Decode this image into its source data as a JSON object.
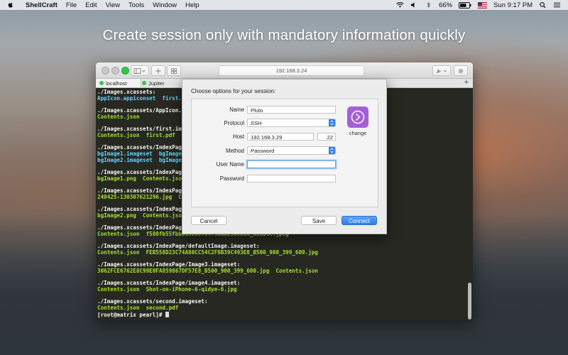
{
  "menubar": {
    "app_name": "ShellCraft",
    "items": [
      "File",
      "Edit",
      "View",
      "Tools",
      "Window",
      "Help"
    ],
    "battery": "66%",
    "clock": "Sun 9:17 PM"
  },
  "headline": "Create session only with mandatory information quickly",
  "window": {
    "address": "192.168.3.24",
    "tabs": [
      {
        "label": "localhost",
        "status_color": "#2ec84a"
      },
      {
        "label": "Jupiter",
        "status_color": "#2ec84a"
      }
    ],
    "new_tab": "+"
  },
  "terminal": {
    "lines": [
      {
        "segments": [
          {
            "text": "./Images.xcassets:",
            "cls": "dir"
          }
        ]
      },
      {
        "segments": [
          {
            "text": "AppIcon.appiconset  first.i",
            "cls": "cyan"
          }
        ]
      },
      {
        "segments": []
      },
      {
        "segments": [
          {
            "text": "./Images.xcassets/AppIcon.ap",
            "cls": "dir"
          }
        ]
      },
      {
        "segments": [
          {
            "text": "Contents.json",
            "cls": "green"
          }
        ]
      },
      {
        "segments": []
      },
      {
        "segments": [
          {
            "text": "./Images.xcassets/first.imag",
            "cls": "dir"
          }
        ]
      },
      {
        "segments": [
          {
            "text": "Contents.json  first.pdf",
            "cls": "green"
          }
        ]
      },
      {
        "segments": []
      },
      {
        "segments": [
          {
            "text": "./Images.xcassets/IndexPage:",
            "cls": "dir"
          }
        ]
      },
      {
        "segments": [
          {
            "text": "bgImage1.imageset  bgImage3",
            "cls": "cyan"
          }
        ]
      },
      {
        "segments": [
          {
            "text": "bgImage2.imageset  bgImage4",
            "cls": "cyan"
          }
        ]
      },
      {
        "segments": []
      },
      {
        "segments": [
          {
            "text": "./Images.xcassets/IndexPage/",
            "cls": "dir"
          }
        ]
      },
      {
        "segments": [
          {
            "text": "bgImage1.png  Contents.json",
            "cls": "green"
          }
        ]
      },
      {
        "segments": []
      },
      {
        "segments": [
          {
            "text": "./Images.xcassets/IndexPage/",
            "cls": "dir"
          }
        ]
      },
      {
        "segments": [
          {
            "text": "240425-130307621296.jpg  Co",
            "cls": "green"
          }
        ]
      },
      {
        "segments": []
      },
      {
        "segments": [
          {
            "text": "./Images.xcassets/IndexPage/",
            "cls": "dir"
          }
        ]
      },
      {
        "segments": [
          {
            "text": "bgImage2.png  Contents.json",
            "cls": "green"
          }
        ]
      },
      {
        "segments": []
      },
      {
        "segments": [
          {
            "text": "./Images.xcassets/IndexPage/",
            "cls": "dir"
          }
        ]
      },
      {
        "segments": [
          {
            "text": "Contents.json  f580fb55fbb8182a0f0479baa25acb16_middle.jpeg",
            "cls": "green"
          }
        ]
      },
      {
        "segments": []
      },
      {
        "segments": [
          {
            "text": "./Images.xcassets/IndexPage/defaultImage.imageset:",
            "cls": "dir"
          }
        ]
      },
      {
        "segments": [
          {
            "text": "Contents.json  FEB558D23C74A80CC54C2F8B39C493E8_B500_900_399_600.jpg",
            "cls": "green"
          }
        ]
      },
      {
        "segments": []
      },
      {
        "segments": [
          {
            "text": "./Images.xcassets/IndexPage/Image3.imageset:",
            "cls": "dir"
          }
        ]
      },
      {
        "segments": [
          {
            "text": "3062FCE6762E8C99E0FA859867DF57E8_B500_900_399_600.jpg  Contents.json",
            "cls": "green"
          }
        ]
      },
      {
        "segments": []
      },
      {
        "segments": [
          {
            "text": "./Images.xcassets/IndexPage/image4.imageset:",
            "cls": "dir"
          }
        ]
      },
      {
        "segments": [
          {
            "text": "Contents.json  Shot-on-iPhone-6-qidye-6.jpg",
            "cls": "green"
          }
        ]
      },
      {
        "segments": []
      },
      {
        "segments": [
          {
            "text": "./Images.xcassets/second.imageset:",
            "cls": "dir"
          }
        ]
      },
      {
        "segments": [
          {
            "text": "Contents.json  second.pdf",
            "cls": "green"
          }
        ]
      },
      {
        "segments": [
          {
            "text": "[root@matrix pearl]# ",
            "cls": "dir"
          }
        ],
        "cursor": true
      }
    ]
  },
  "dialog": {
    "title": "Choose options for your session:",
    "name_label": "Name",
    "name_value": "Pluto",
    "protocol_label": "Protocol",
    "protocol_value": "SSH",
    "host_label": "Host",
    "host_value": "192.168.3.29",
    "port_value": "22",
    "method_label": "Method",
    "method_value": "Password",
    "username_label": "User Name",
    "username_value": "",
    "password_label": "Password",
    "password_value": "",
    "icon_label": "change",
    "cancel": "Cancel",
    "save": "Save",
    "connect": "Connect",
    "accent": "#2f7de3",
    "icon_color": "#a55fd6"
  }
}
